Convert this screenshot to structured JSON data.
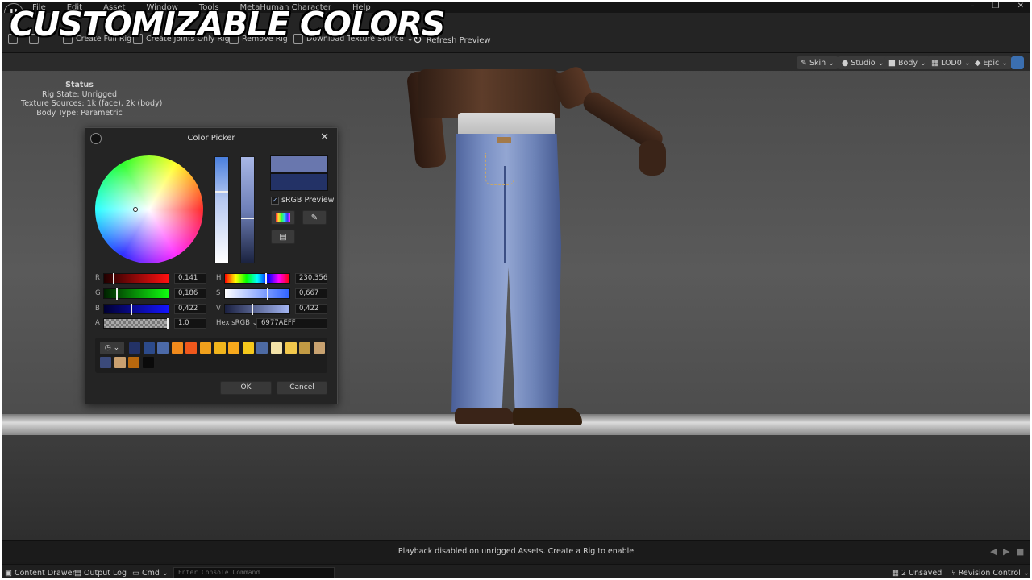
{
  "headline": "CUSTOMIZABLE COLORS",
  "menu": [
    "File",
    "Edit",
    "Asset",
    "Window",
    "Tools",
    "MetaHuman Character",
    "Help"
  ],
  "toolbar": {
    "create_full_rig": "Create Full Rig",
    "create_joints_only_rig": "Create Joints Only Rig",
    "remove_rig": "Remove Rig",
    "download_texture_source": "Download Texture Source",
    "refresh_preview": "Refresh Preview"
  },
  "viewport_toolbar": {
    "skin": "Skin",
    "studio": "Studio",
    "body": "Body",
    "lod": "LOD0",
    "quality": "Epic"
  },
  "status": {
    "title": "Status",
    "rig_state": "Rig State: Unrigged",
    "texture_sources": "Texture Sources: 1k (face), 2k (body)",
    "body_type": "Body Type: Parametric"
  },
  "color_picker": {
    "title": "Color Picker",
    "new_color": "#6977ae",
    "old_color": "#233266",
    "srgb_preview": "sRGB Preview",
    "channels": {
      "r": {
        "label": "R",
        "value": "0,141",
        "fraction": 0.141
      },
      "g": {
        "label": "G",
        "value": "0,186",
        "fraction": 0.186
      },
      "b": {
        "label": "B",
        "value": "0,422",
        "fraction": 0.422
      },
      "a": {
        "label": "A",
        "value": "1,0",
        "fraction": 1.0
      },
      "h": {
        "label": "H",
        "value": "230,356",
        "fraction": 0.64
      },
      "s": {
        "label": "S",
        "value": "0,667",
        "fraction": 0.667
      },
      "v": {
        "label": "V",
        "value": "0,422",
        "fraction": 0.422
      }
    },
    "hex_label": "Hex sRGB",
    "hex_value": "6977AEFF",
    "swatches": [
      "#233266",
      "#2c4a8a",
      "#4c6aa8",
      "#f08a1c",
      "#f0581c",
      "#f0a01c",
      "#f0b41c",
      "#f7a81c",
      "#f5c81c",
      "#4d6aa3",
      "#f2e2a8",
      "#f2c84c",
      "#c29a44",
      "#c8a270",
      "#3b4a7a",
      "#c9a070",
      "#b8680e",
      "#0a0a0a"
    ],
    "ok": "OK",
    "cancel": "Cancel"
  },
  "playback": {
    "message": "Playback disabled on unrigged Assets. Create a Rig to enable"
  },
  "bottom_bar": {
    "content_drawer": "Content Drawer",
    "output_log": "Output Log",
    "cmd": "Cmd",
    "console_placeholder": "Enter Console Command",
    "unsaved": "2 Unsaved",
    "revision_control": "Revision Control"
  }
}
